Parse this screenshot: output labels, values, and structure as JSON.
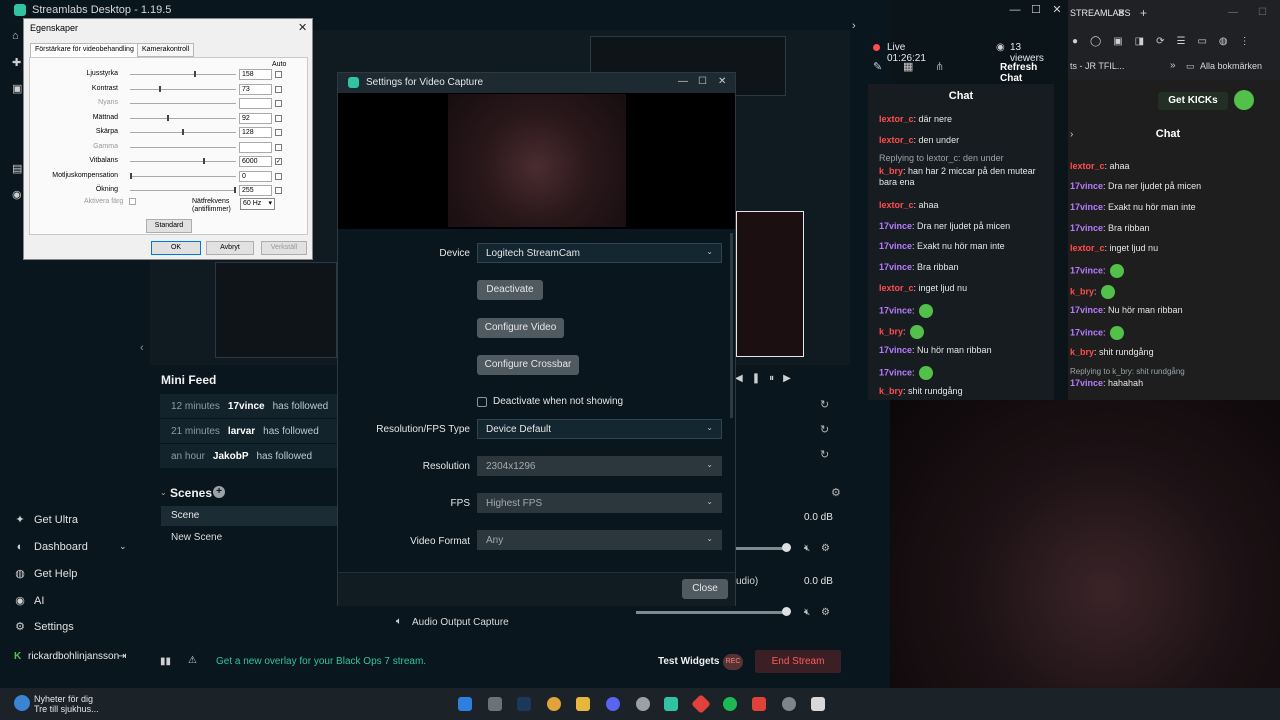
{
  "streamlabs": {
    "title": "Streamlabs Desktop - 1.19.5",
    "nav": {
      "get_ultra": "Get Ultra",
      "dashboard": "Dashboard",
      "get_help": "Get Help",
      "ai": "AI",
      "settings": "Settings"
    },
    "user": "rickardbohlinjansson",
    "mini_feed": {
      "title": "Mini Feed",
      "rows": [
        {
          "time": "12 minutes",
          "user": "17vince",
          "action": "has followed"
        },
        {
          "time": "21 minutes",
          "user": "larvar",
          "action": "has followed"
        },
        {
          "time": "an hour",
          "user": "JakobP",
          "action": "has followed"
        }
      ]
    },
    "scenes": {
      "title": "Scenes",
      "header": "Scene",
      "item": "New Scene"
    },
    "audio_source": "Audio Output Capture",
    "mixer": {
      "db1": "0.0 dB",
      "db2": "0.0 dB",
      "label": "udio)"
    },
    "promo": "Get a new overlay for your Black Ops 7 stream.",
    "test_widgets": "Test Widgets",
    "rec": "REC",
    "end_stream": "End Stream",
    "live": "Live 01:26:21",
    "viewers": "13 viewers",
    "refresh_chat": "Refresh Chat",
    "chat_title": "Chat",
    "chat": [
      {
        "user": "lextor_c",
        "color": "#ff4d4d",
        "text": ": där nere"
      },
      {
        "user": "lextor_c",
        "color": "#ff4d4d",
        "text": ": den under"
      },
      {
        "user": "",
        "color": "#9aa4a9",
        "text": "Replying to lextor_c: den under"
      },
      {
        "user": "k_bry",
        "color": "#ff4d4d",
        "text": ": han har 2 miccar på den mutear bara ena"
      },
      {
        "user": "lextor_c",
        "color": "#ff4d4d",
        "text": ": ahaa"
      },
      {
        "user": "17vince",
        "color": "#b67cff",
        "text": ": Dra ner ljudet på micen"
      },
      {
        "user": "17vince",
        "color": "#b67cff",
        "text": ": Exakt nu hör man inte"
      },
      {
        "user": "17vince",
        "color": "#b67cff",
        "text": ": Bra ribban"
      },
      {
        "user": "lextor_c",
        "color": "#ff4d4d",
        "text": ": inget ljud nu"
      },
      {
        "user": "17vince",
        "color": "#b67cff",
        "text": ":"
      },
      {
        "user": "k_bry",
        "color": "#ff4d4d",
        "text": ":"
      },
      {
        "user": "17vince",
        "color": "#b67cff",
        "text": ": Nu hör man ribban"
      },
      {
        "user": "17vince",
        "color": "#b67cff",
        "text": ":"
      },
      {
        "user": "k_bry",
        "color": "#ff4d4d",
        "text": ": shit rundgång"
      }
    ]
  },
  "chrome": {
    "tab": "STREAMLABS",
    "bookmark_jr": "ts - JR TFIL...",
    "bookmarks": "Alla bokmärken",
    "get_kicks": "Get KICKs",
    "chat_title": "Chat",
    "chat": [
      {
        "user": "lextor_c",
        "color": "#ff4d4d",
        "text": ": ahaa"
      },
      {
        "user": "17vince",
        "color": "#b67cff",
        "text": ": Dra ner ljudet på micen"
      },
      {
        "user": "17vince",
        "color": "#b67cff",
        "text": ": Exakt nu hör man inte"
      },
      {
        "user": "17vince",
        "color": "#b67cff",
        "text": ": Bra ribban"
      },
      {
        "user": "lextor_c",
        "color": "#ff4d4d",
        "text": ": inget ljud nu"
      },
      {
        "user": "17vince",
        "color": "#b67cff",
        "text": ":"
      },
      {
        "user": "k_bry",
        "color": "#ff4d4d",
        "text": ":"
      },
      {
        "user": "17vince",
        "color": "#b67cff",
        "text": ": Nu hör man ribban"
      },
      {
        "user": "17vince",
        "color": "#b67cff",
        "text": ":"
      },
      {
        "user": "k_bry",
        "color": "#ff4d4d",
        "text": ": shit rundgång"
      },
      {
        "user": "",
        "color": "#9aa4a9",
        "text": "Replying to k_bry: shit rundgång"
      },
      {
        "user": "17vince",
        "color": "#b67cff",
        "text": ": hahahah"
      }
    ]
  },
  "properties": {
    "title": "Egenskaper",
    "tab1": "Förstärkare för videobehandling",
    "tab2": "Kamerakontroll",
    "auto": "Auto",
    "rows": [
      {
        "label": "Ljusstyrka",
        "value": "158",
        "level": 0.62,
        "enabled": true,
        "auto": false
      },
      {
        "label": "Kontrast",
        "value": "73",
        "level": 0.28,
        "enabled": true,
        "auto": false
      },
      {
        "label": "Nyans",
        "value": "",
        "level": 0.0,
        "enabled": false,
        "auto": false
      },
      {
        "label": "Mättnad",
        "value": "92",
        "level": 0.36,
        "enabled": true,
        "auto": false
      },
      {
        "label": "Skärpa",
        "value": "128",
        "level": 0.5,
        "enabled": true,
        "auto": false
      },
      {
        "label": "Gamma",
        "value": "",
        "level": 0.0,
        "enabled": false,
        "auto": false
      },
      {
        "label": "Vitbalans",
        "value": "6000",
        "level": 0.7,
        "enabled": true,
        "auto": true
      },
      {
        "label": "Motljuskompensation",
        "value": "0",
        "level": 0.0,
        "enabled": true,
        "auto": false
      },
      {
        "label": "Ökning",
        "value": "255",
        "level": 1.0,
        "enabled": true,
        "auto": false
      }
    ],
    "aktivera_farg": "Aktivera färg",
    "natfrekvens_line1": "Nätfrekvens",
    "natfrekvens_line2": "(antiflimmer)",
    "natfrekvens_value": "60 Hz",
    "standard": "Standard",
    "ok": "OK",
    "avbryt": "Avbryt",
    "verkstall": "Verkställ"
  },
  "video_capture": {
    "title": "Settings for Video Capture",
    "device_label": "Device",
    "device_value": "Logitech StreamCam",
    "deactivate": "Deactivate",
    "configure_video": "Configure Video",
    "configure_crossbar": "Configure Crossbar",
    "deactivate_not_showing": "Deactivate when not showing",
    "res_fps_type_label": "Resolution/FPS Type",
    "res_fps_type_value": "Device Default",
    "resolution_label": "Resolution",
    "resolution_value": "2304x1296",
    "fps_label": "FPS",
    "fps_value": "Highest FPS",
    "video_format_label": "Video Format",
    "video_format_value": "Any",
    "close": "Close"
  },
  "taskbar": {
    "news_title": "Nyheter för dig",
    "news_sub": "Tre till sjukhus..."
  }
}
